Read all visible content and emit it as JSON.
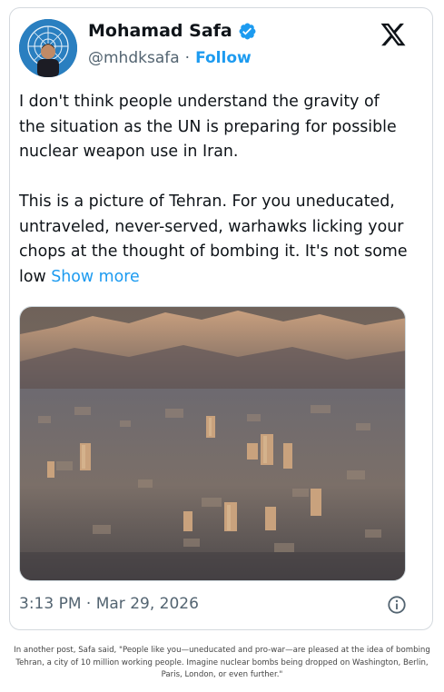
{
  "tweet": {
    "author": {
      "display_name": "Mohamad Safa",
      "handle": "@mhdksafa",
      "verified": true,
      "avatar_icon": "avatar-photo-un-emblem"
    },
    "follow_label": "Follow",
    "separator": "·",
    "platform_icon": "x-logo-icon",
    "text_part1": "I don't think people understand the gravity of the situation as the UN is preparing for possible nuclear weapon use in Iran.\n\nThis is a picture of Tehran. For you uneducated, untraveled, never-served, warhawks licking your chops at the thought of bombing it. It's not some low ",
    "show_more_label": "Show more",
    "image": {
      "description_icon": "tehran-aerial-photo"
    },
    "timestamp": "3:13 PM · Mar 29, 2026",
    "info_icon": "info-icon"
  },
  "caption": "In another post, Safa said, \"People like you—uneducated and pro-war—are pleased at the idea of bombing Tehran, a city of 10 million working people. Imagine nuclear bombs being dropped on Washington, Berlin, Paris, London, or even further.\"",
  "colors": {
    "link": "#1d9bf0",
    "text": "#0f1419",
    "muted": "#536471",
    "border": "#d4d9de"
  }
}
